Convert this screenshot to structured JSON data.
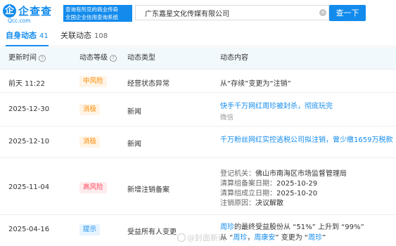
{
  "header": {
    "logo_text": "企查查",
    "logo_url": "Qcc.com",
    "slogan_line1": "查询有所见的商业传奇",
    "slogan_line2": "全国企业信用查询系统",
    "search_value": "广东嘉星文化传媒有限公司",
    "clear_icon": "×",
    "search_button": "查一下"
  },
  "tabs": [
    {
      "label": "自身动态",
      "count": "41"
    },
    {
      "label": "关联动态",
      "count": "108"
    }
  ],
  "table": {
    "headers": {
      "time": "更新时间",
      "level": "动态等级",
      "type": "动态类型",
      "content": "动态内容"
    },
    "help_icon": "?",
    "rows": [
      {
        "time": "前天 11:22",
        "level": "中风险",
        "type": "经营状态异常",
        "content": "从“存续”变更为“注销”"
      },
      {
        "time": "2025-12-30",
        "level": "消极",
        "type": "新闻",
        "title": "快手千万网红周珍被封杀，彻底玩完",
        "source": "微信"
      },
      {
        "time": "2025-12-10",
        "level": "消极",
        "type": "新闻",
        "title": "千万粉丝网红实控逃税公司拟注销，曾少缴1659万税款"
      },
      {
        "time": "2025-11-04",
        "level": "高风险",
        "type": "新增注销备案",
        "lines": [
          {
            "label": "登记机关：",
            "value": "佛山市南海区市场监督管理局"
          },
          {
            "label": "清算组备案日期：",
            "value": "2025-10-29"
          },
          {
            "label": "清算组成立日期：",
            "value": "2025-10-20"
          },
          {
            "label": "注销原因：",
            "value": "决议解散"
          }
        ]
      },
      {
        "time": "2025-04-16",
        "level": "提示",
        "type": "受益所有人变更",
        "line1_name": "周珍",
        "line1_text": "的最终受益股份从 “51%” 上升到 “99%”",
        "line2_from": "从 “",
        "line2_old1": "周珍",
        "line2_sep": "，",
        "line2_old2": "周康安",
        "line2_mid": "” 变更为 “",
        "line2_new": "周珍",
        "line2_end": "”"
      }
    ]
  },
  "watermark": "@封面新闻",
  "colors": {
    "brand_blue": "#128bed",
    "risk_orange": "#ff8900",
    "risk_red": "#fd485e",
    "header_bg": "#f2f9fc"
  }
}
